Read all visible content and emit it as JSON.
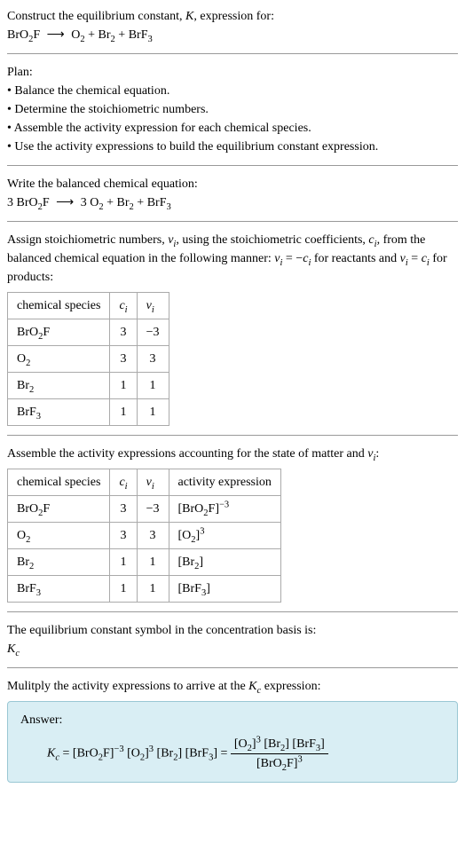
{
  "intro": {
    "line1": "Construct the equilibrium constant, ",
    "kvar": "K",
    "line1b": ", expression for:",
    "eq_lhs": "BrO",
    "eq_arrow": "⟶",
    "eq_rhs_o2": "O",
    "eq_plus": " + ",
    "eq_br2": "Br",
    "eq_brf3": "BrF"
  },
  "plan": {
    "title": "Plan:",
    "b1": "• Balance the chemical equation.",
    "b2": "• Determine the stoichiometric numbers.",
    "b3": "• Assemble the activity expression for each chemical species.",
    "b4": "• Use the activity expressions to build the equilibrium constant expression."
  },
  "balanced": {
    "title": "Write the balanced chemical equation:",
    "lhs_coef": "3 ",
    "lhs": "BrO",
    "arrow": "⟶",
    "rhs_coef1": "3 ",
    "o2": "O",
    "plus": " + ",
    "br2": "Br",
    "brf3": "BrF"
  },
  "stoich_text": {
    "p1a": "Assign stoichiometric numbers, ",
    "nu": "ν",
    "p1b": ", using the stoichiometric coefficients, ",
    "c": "c",
    "p1c": ", from the balanced chemical equation in the following manner: ",
    "eq1": " = −",
    "p1d": " for reactants and ",
    "eq2": " = ",
    "p1e": " for products:"
  },
  "table1": {
    "h1": "chemical species",
    "h2": "c",
    "h3": "ν",
    "rows": [
      {
        "sp_a": "BrO",
        "sp_sub": "2",
        "sp_b": "F",
        "c": "3",
        "nu": "−3"
      },
      {
        "sp_a": "O",
        "sp_sub": "2",
        "sp_b": "",
        "c": "3",
        "nu": "3"
      },
      {
        "sp_a": "Br",
        "sp_sub": "2",
        "sp_b": "",
        "c": "1",
        "nu": "1"
      },
      {
        "sp_a": "BrF",
        "sp_sub": "3",
        "sp_b": "",
        "c": "1",
        "nu": "1"
      }
    ]
  },
  "activity_text": "Assemble the activity expressions accounting for the state of matter and ",
  "activity_text2": ":",
  "table2": {
    "h1": "chemical species",
    "h2": "c",
    "h3": "ν",
    "h4": "activity expression",
    "rows": [
      {
        "sp_a": "BrO",
        "sp_sub": "2",
        "sp_b": "F",
        "c": "3",
        "nu": "−3",
        "act_a": "[BrO",
        "act_sub": "2",
        "act_b": "F]",
        "act_sup": "−3"
      },
      {
        "sp_a": "O",
        "sp_sub": "2",
        "sp_b": "",
        "c": "3",
        "nu": "3",
        "act_a": "[O",
        "act_sub": "2",
        "act_b": "]",
        "act_sup": "3"
      },
      {
        "sp_a": "Br",
        "sp_sub": "2",
        "sp_b": "",
        "c": "1",
        "nu": "1",
        "act_a": "[Br",
        "act_sub": "2",
        "act_b": "]",
        "act_sup": ""
      },
      {
        "sp_a": "BrF",
        "sp_sub": "3",
        "sp_b": "",
        "c": "1",
        "nu": "1",
        "act_a": "[BrF",
        "act_sub": "3",
        "act_b": "]",
        "act_sup": ""
      }
    ]
  },
  "kc_text": {
    "line1": "The equilibrium constant symbol in the concentration basis is:",
    "kc": "K"
  },
  "multiply_text": {
    "line1a": "Mulitply the activity expressions to arrive at the ",
    "line1b": " expression:"
  },
  "answer": {
    "label": "Answer:",
    "kc": "K",
    "eq": " = ",
    "t1": "[BrO",
    "t2": "F]",
    "t3": " [O",
    "t4": "]",
    "t5": " [Br",
    "t6": "] [BrF",
    "t7": "] = ",
    "num1": "[O",
    "num2": "]",
    "num3": " [Br",
    "num4": "] [BrF",
    "num5": "]",
    "den1": "[BrO",
    "den2": "F]"
  },
  "subs": {
    "two": "2",
    "three": "3",
    "i": "i",
    "c": "c"
  },
  "sups": {
    "neg3": "−3",
    "three": "3"
  }
}
